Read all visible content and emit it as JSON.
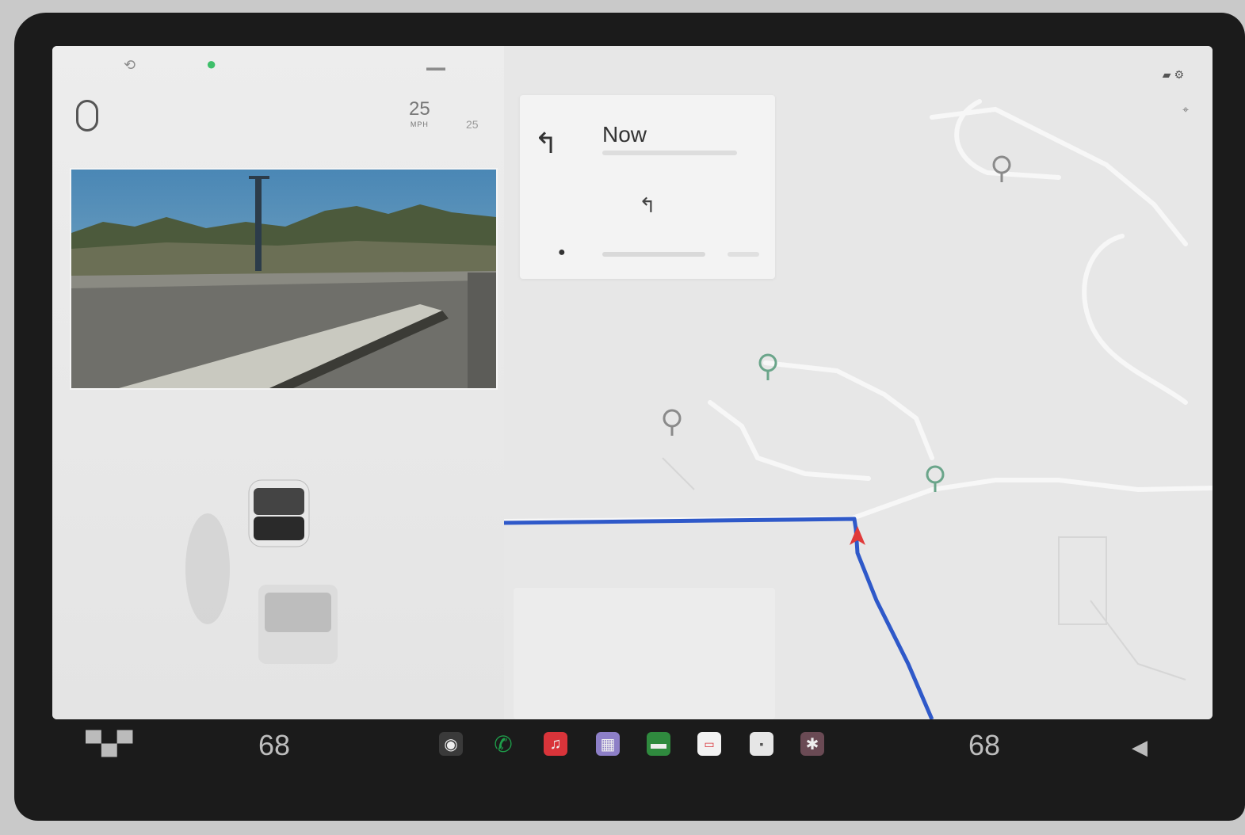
{
  "drive": {
    "speed": "25",
    "speed_unit": "MPH",
    "speed_limit_top": "",
    "speed_limit_value": "25"
  },
  "navigation": {
    "instruction_time": "Now",
    "instruction_icon": "turn-left-icon",
    "next_icon": "turn-left-icon",
    "destination_icon": "location-pin-icon"
  },
  "taskbar": {
    "driver_temp": "68",
    "passenger_temp": "68",
    "apps": [
      {
        "name": "camera-icon",
        "color": "#3a3a3a"
      },
      {
        "name": "phone-icon",
        "color": "#1e9e4a"
      },
      {
        "name": "music-icon",
        "color": "#d9343a"
      },
      {
        "name": "app-icon",
        "color": "#8d7fc7"
      },
      {
        "name": "messages-icon",
        "color": "#2f8a3e"
      },
      {
        "name": "calendar-icon",
        "color": "#f2f2f2"
      },
      {
        "name": "toybox-icon",
        "color": "#e6e6e6"
      },
      {
        "name": "media-icon",
        "color": "#6a4a54"
      }
    ]
  },
  "colors": {
    "route": "#2f59c9",
    "car_marker": "#e03a3a",
    "pin": "#6aa58a"
  }
}
